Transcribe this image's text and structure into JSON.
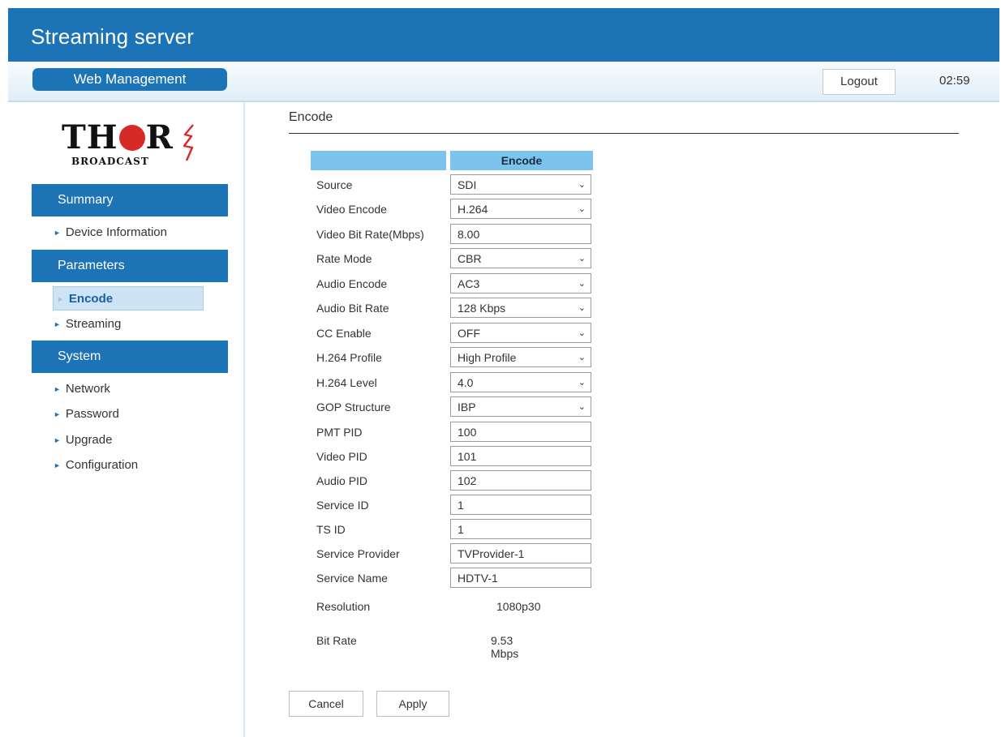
{
  "app": {
    "title": "Streaming server"
  },
  "topbar": {
    "web_management": "Web Management",
    "logout": "Logout",
    "clock": "02:59"
  },
  "logo": {
    "word_left": "TH",
    "word_right": "R",
    "subtext": "BROADCAST"
  },
  "sidebar": {
    "sections": [
      {
        "label": "Summary",
        "items": [
          "Device Information"
        ]
      },
      {
        "label": "Parameters",
        "items": [
          "Encode",
          "Streaming"
        ]
      },
      {
        "label": "System",
        "items": [
          "Network",
          "Password",
          "Upgrade",
          "Configuration"
        ]
      }
    ],
    "active": "Encode"
  },
  "page": {
    "title": "Encode"
  },
  "form": {
    "header": "Encode",
    "rows": [
      {
        "label": "Source",
        "value": "SDI",
        "type": "select"
      },
      {
        "label": "Video Encode",
        "value": "H.264",
        "type": "select"
      },
      {
        "label": "Video Bit Rate(Mbps)",
        "value": "8.00",
        "type": "input"
      },
      {
        "label": "Rate Mode",
        "value": "CBR",
        "type": "select"
      },
      {
        "label": "Audio Encode",
        "value": "AC3",
        "type": "select"
      },
      {
        "label": "Audio Bit Rate",
        "value": "128 Kbps",
        "type": "select"
      },
      {
        "label": "CC Enable",
        "value": "OFF",
        "type": "select"
      },
      {
        "label": "H.264 Profile",
        "value": "High Profile",
        "type": "select"
      },
      {
        "label": "H.264 Level",
        "value": "4.0",
        "type": "select"
      },
      {
        "label": "GOP Structure",
        "value": "IBP",
        "type": "select"
      },
      {
        "label": "PMT PID",
        "value": "100",
        "type": "input"
      },
      {
        "label": "Video PID",
        "value": "101",
        "type": "input"
      },
      {
        "label": "Audio PID",
        "value": "102",
        "type": "input"
      },
      {
        "label": "Service ID",
        "value": "1",
        "type": "input"
      },
      {
        "label": "TS ID",
        "value": "1",
        "type": "input"
      },
      {
        "label": "Service Provider",
        "value": "TVProvider-1",
        "type": "input"
      },
      {
        "label": "Service Name",
        "value": "HDTV-1",
        "type": "input"
      }
    ],
    "resolution": {
      "label": "Resolution",
      "value": "1080p30"
    },
    "bitrate": {
      "label": "Bit Rate",
      "value": "9.53 Mbps"
    }
  },
  "buttons": {
    "cancel": "Cancel",
    "apply": "Apply"
  },
  "colors": {
    "brand_blue": "#1c73b6",
    "header_light_blue": "#7cc3ee",
    "active_item_bg": "#cde4f6",
    "logo_red": "#d62a26"
  },
  "icons": {
    "dropdown": "chevron-down-icon",
    "nav_bullet": "triangle-right-icon"
  }
}
